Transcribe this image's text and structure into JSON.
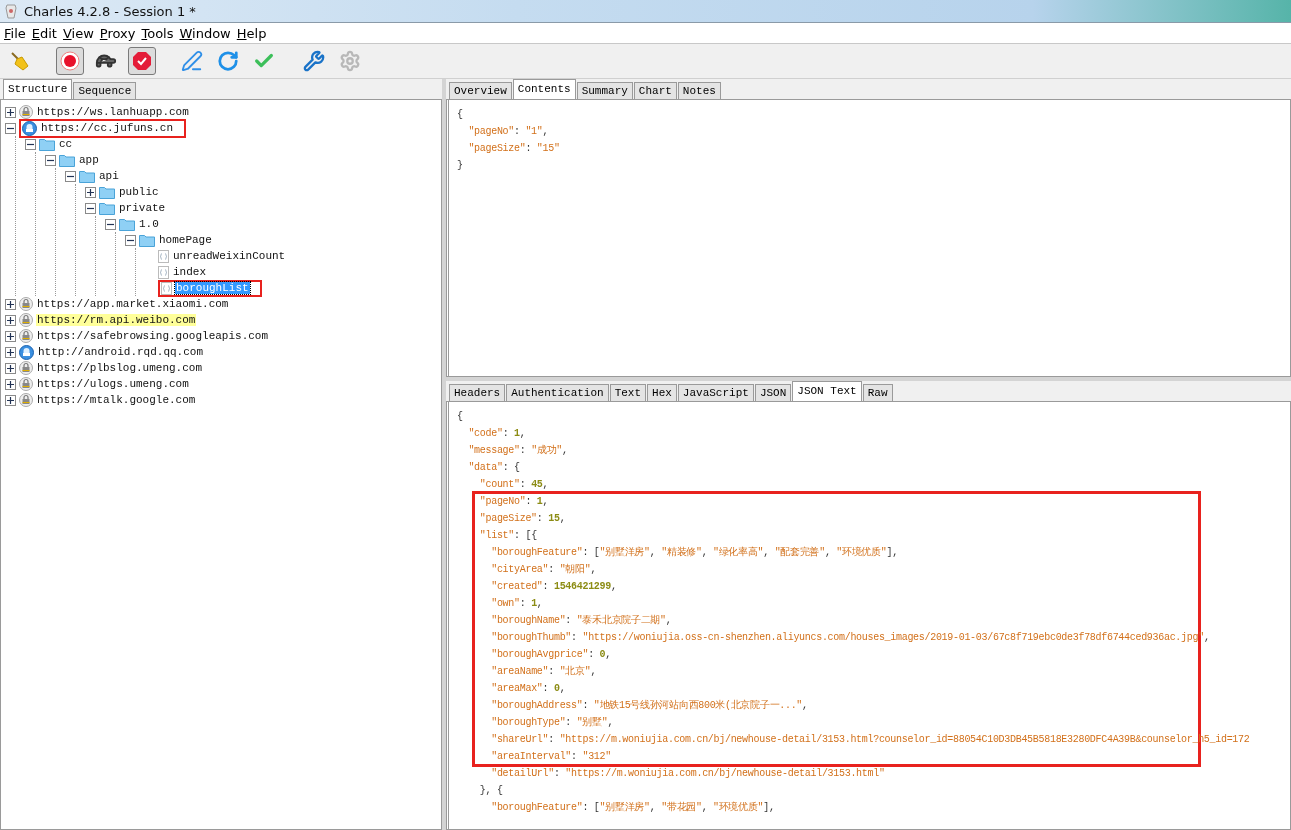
{
  "window": {
    "title": "Charles 4.2.8 - Session 1 *"
  },
  "menu": [
    "File",
    "Edit",
    "View",
    "Proxy",
    "Tools",
    "Window",
    "Help"
  ],
  "toolbar": [
    [
      {
        "kind": "clear"
      }
    ],
    [
      {
        "kind": "record",
        "on": true
      },
      {
        "kind": "throttle",
        "on": false
      },
      {
        "kind": "breakpoints",
        "on": true
      }
    ],
    [
      {
        "kind": "compose"
      },
      {
        "kind": "repeat"
      },
      {
        "kind": "validate"
      }
    ],
    [
      {
        "kind": "tools"
      },
      {
        "kind": "settings"
      }
    ]
  ],
  "left_tabs": [
    {
      "label": "Structure",
      "selected": true
    },
    {
      "label": "Sequence",
      "selected": false
    }
  ],
  "tree": [
    {
      "label": "https://ws.lanhuapp.com",
      "kind": "secure-host",
      "expanded": false,
      "selected": false,
      "highlighted": false,
      "marked": false
    },
    {
      "label": "https://cc.jufuns.cn",
      "kind": "host",
      "expanded": true,
      "selected": false,
      "highlighted": false,
      "marked": true,
      "children": [
        {
          "label": "cc",
          "kind": "folder",
          "expanded": true,
          "selected": false,
          "highlighted": false,
          "marked": false,
          "children": [
            {
              "label": "app",
              "kind": "folder",
              "expanded": true,
              "selected": false,
              "highlighted": false,
              "marked": false,
              "children": [
                {
                  "label": "api",
                  "kind": "folder",
                  "expanded": true,
                  "selected": false,
                  "highlighted": false,
                  "marked": false,
                  "children": [
                    {
                      "label": "public",
                      "kind": "folder",
                      "expanded": false,
                      "selected": false,
                      "highlighted": false,
                      "marked": false
                    },
                    {
                      "label": "private",
                      "kind": "folder",
                      "expanded": true,
                      "selected": false,
                      "highlighted": false,
                      "marked": false,
                      "children": [
                        {
                          "label": "1.0",
                          "kind": "folder",
                          "expanded": true,
                          "selected": false,
                          "highlighted": false,
                          "marked": false,
                          "children": [
                            {
                              "label": "homePage",
                              "kind": "folder",
                              "expanded": true,
                              "selected": false,
                              "highlighted": false,
                              "marked": false,
                              "children": [
                                {
                                  "label": "unreadWeixinCount",
                                  "kind": "file",
                                  "selected": false,
                                  "highlighted": false,
                                  "marked": false
                                },
                                {
                                  "label": "index",
                                  "kind": "file",
                                  "selected": false,
                                  "highlighted": false,
                                  "marked": false
                                },
                                {
                                  "label": "boroughList",
                                  "kind": "file",
                                  "selected": true,
                                  "highlighted": false,
                                  "marked": true
                                }
                              ]
                            }
                          ]
                        }
                      ]
                    }
                  ]
                }
              ]
            }
          ]
        }
      ]
    },
    {
      "label": "https://app.market.xiaomi.com",
      "kind": "secure-host",
      "expanded": false,
      "selected": false,
      "highlighted": false,
      "marked": false
    },
    {
      "label": "https://rm.api.weibo.com",
      "kind": "secure-host",
      "expanded": false,
      "selected": false,
      "highlighted": true,
      "marked": false
    },
    {
      "label": "https://safebrowsing.googleapis.com",
      "kind": "secure-host",
      "expanded": false,
      "selected": false,
      "highlighted": false,
      "marked": false
    },
    {
      "label": "http://android.rqd.qq.com",
      "kind": "host",
      "expanded": false,
      "selected": false,
      "highlighted": false,
      "marked": false
    },
    {
      "label": "https://plbslog.umeng.com",
      "kind": "secure-host",
      "expanded": false,
      "selected": false,
      "highlighted": false,
      "marked": false
    },
    {
      "label": "https://ulogs.umeng.com",
      "kind": "secure-host",
      "expanded": false,
      "selected": false,
      "highlighted": false,
      "marked": false
    },
    {
      "label": "https://mtalk.google.com",
      "kind": "secure-host",
      "expanded": false,
      "selected": false,
      "highlighted": false,
      "marked": false
    }
  ],
  "request_tabs": [
    {
      "label": "Overview",
      "selected": false
    },
    {
      "label": "Contents",
      "selected": true
    },
    {
      "label": "Summary",
      "selected": false
    },
    {
      "label": "Chart",
      "selected": false
    },
    {
      "label": "Notes",
      "selected": false
    }
  ],
  "request_body": [
    {
      "text": "{",
      "marked": false
    },
    {
      "text": "  \"pageNo\": \"1\",",
      "marked": false
    },
    {
      "text": "  \"pageSize\": \"15\"",
      "marked": false
    },
    {
      "text": "}",
      "marked": false
    }
  ],
  "response_tabs": [
    {
      "label": "Headers",
      "selected": false
    },
    {
      "label": "Authentication",
      "selected": false
    },
    {
      "label": "Text",
      "selected": false
    },
    {
      "label": "Hex",
      "selected": false
    },
    {
      "label": "JavaScript",
      "selected": false
    },
    {
      "label": "JSON",
      "selected": false
    },
    {
      "label": "JSON Text",
      "selected": true
    },
    {
      "label": "Raw",
      "selected": false
    }
  ],
  "response_body": [
    {
      "text": "{",
      "marked": false
    },
    {
      "text": "  \"code\": 1,",
      "marked": false
    },
    {
      "text": "  \"message\": \"成功\",",
      "marked": false
    },
    {
      "text": "  \"data\": {",
      "marked": false
    },
    {
      "text": "    \"count\": 45,",
      "marked": false
    },
    {
      "text": "    \"pageNo\": 1,",
      "marked": true
    },
    {
      "text": "    \"pageSize\": 15,",
      "marked": true
    },
    {
      "text": "    \"list\": [{",
      "marked": true
    },
    {
      "text": "      \"boroughFeature\": [\"别墅洋房\", \"精装修\", \"绿化率高\", \"配套完善\", \"环境优质\"],",
      "marked": true
    },
    {
      "text": "      \"cityArea\": \"朝阳\",",
      "marked": true
    },
    {
      "text": "      \"created\": 1546421299,",
      "marked": true
    },
    {
      "text": "      \"own\": 1,",
      "marked": true
    },
    {
      "text": "      \"boroughName\": \"泰禾北京院子二期\",",
      "marked": true
    },
    {
      "text": "      \"boroughThumb\": \"https://woniujia.oss-cn-shenzhen.aliyuncs.com/houses_images/2019-01-03/67c8f719ebc0de3f78df6744ced936ac.jpg\",",
      "marked": true
    },
    {
      "text": "      \"boroughAvgprice\": 0,",
      "marked": true
    },
    {
      "text": "      \"areaName\": \"北京\",",
      "marked": true
    },
    {
      "text": "      \"areaMax\": 0,",
      "marked": true
    },
    {
      "text": "      \"boroughAddress\": \"地铁15号线孙河站向西800米(北京院子一...\",",
      "marked": true
    },
    {
      "text": "      \"boroughType\": \"别墅\",",
      "marked": true
    },
    {
      "text": "      \"shareUrl\": \"https://m.woniujia.com.cn/bj/newhouse-detail/3153.html?counselor_id=88054C10D3DB45B5818E3280DFC4A39B&counselor_h5_id=172",
      "marked": true
    },
    {
      "text": "      \"areaInterval\": \"312\"",
      "marked": true
    },
    {
      "text": "      \"detailUrl\": \"https://m.woniujia.com.cn/bj/newhouse-detail/3153.html\"",
      "marked": false
    },
    {
      "text": "    }, {",
      "marked": false
    },
    {
      "text": "      \"boroughFeature\": [\"别墅洋房\", \"带花园\", \"环境优质\"],",
      "marked": false
    }
  ]
}
